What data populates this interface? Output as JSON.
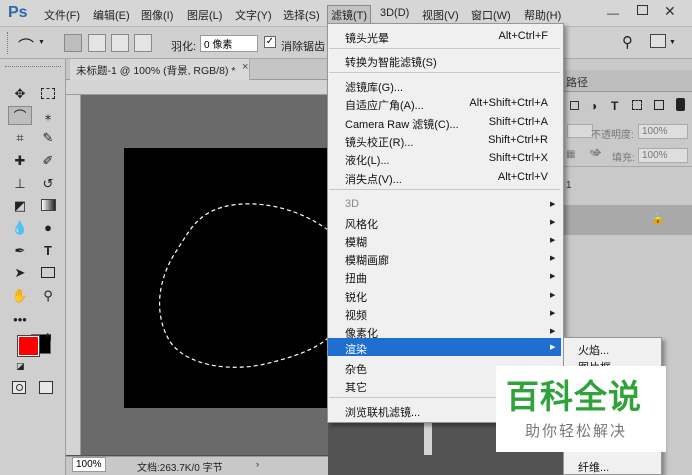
{
  "menubar": {
    "logo": "Ps",
    "items": [
      "文件(F)",
      "编辑(E)",
      "图像(I)",
      "图层(L)",
      "文字(Y)",
      "选择(S)",
      "滤镜(T)",
      "3D(D)",
      "视图(V)",
      "窗口(W)",
      "帮助(H)"
    ],
    "active": "滤镜(T)"
  },
  "options": {
    "feather_label": "羽化:",
    "feather_value": "0 像素",
    "antialias_label": "消除锯齿"
  },
  "document": {
    "tab_title": "未标题-1 @ 100% (背景, RGB/8) *",
    "zoom": "100%",
    "doc_info": "文档:263.7K/0 字节"
  },
  "filter_menu": {
    "group1": [
      {
        "label": "镜头光晕",
        "shortcut": "Alt+Ctrl+F"
      }
    ],
    "group2": [
      {
        "label": "转换为智能滤镜(S)",
        "shortcut": ""
      }
    ],
    "group3": [
      {
        "label": "滤镜库(G)...",
        "shortcut": ""
      },
      {
        "label": "自适应广角(A)...",
        "shortcut": "Alt+Shift+Ctrl+A"
      },
      {
        "label": "Camera Raw 滤镜(C)...",
        "shortcut": "Shift+Ctrl+A"
      },
      {
        "label": "镜头校正(R)...",
        "shortcut": "Shift+Ctrl+R"
      },
      {
        "label": "液化(L)...",
        "shortcut": "Shift+Ctrl+X"
      },
      {
        "label": "消失点(V)...",
        "shortcut": "Alt+Ctrl+V"
      }
    ],
    "group4": [
      "3D",
      "风格化",
      "模糊",
      "模糊画廊",
      "扭曲",
      "锐化",
      "视频",
      "像素化",
      "渲染",
      "杂色",
      "其它"
    ],
    "highlighted": "渲染",
    "group5": [
      "浏览联机滤镜..."
    ]
  },
  "render_submenu": [
    "火焰...",
    "图片框...",
    "",
    "",
    "",
    "纤维..."
  ],
  "right_panel": {
    "tab_label": "路径",
    "opacity_label": "不透明度:",
    "opacity_value": "100%",
    "fill_label": "填充:",
    "fill_value": "100%",
    "layer_index": "1"
  },
  "watermark": {
    "title": "百科全说",
    "subtitle": "助你轻松解决"
  },
  "colors": {
    "foreground": "#ff0000",
    "background": "#000000",
    "highlight": "#1e6fd0",
    "watermark_green": "#2fa33a"
  }
}
